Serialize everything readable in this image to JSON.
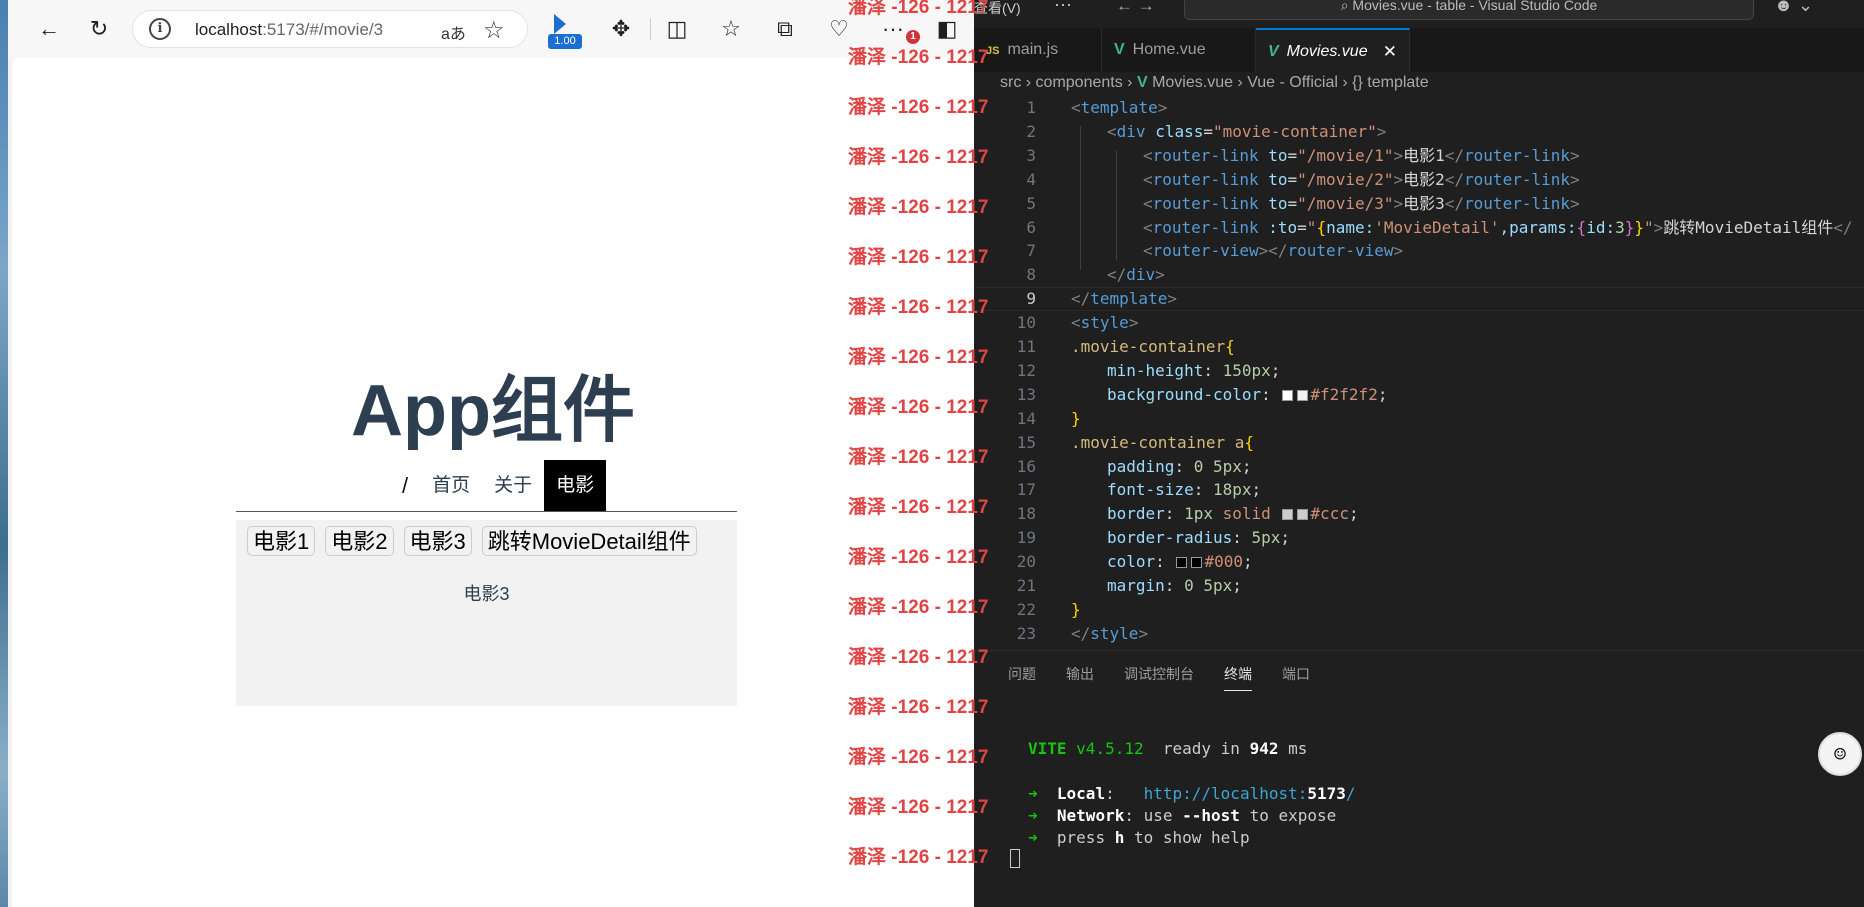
{
  "browser": {
    "url_host": "localhost",
    "url_rest": ":5173/#/movie/3",
    "read_aloud": "aあ",
    "zoom_badge": "1.00",
    "notification_count": "1"
  },
  "app": {
    "title": "App组件",
    "nav": [
      "/",
      "首页",
      "关于",
      "电影"
    ],
    "movie_links": [
      "电影1",
      "电影2",
      "电影3",
      "跳转MovieDetail组件"
    ],
    "router_view_text": "电影3"
  },
  "watermark": {
    "text": "潘泽 -126 - 1217",
    "repeat": 18
  },
  "vscode": {
    "menu_item": "查看(V)",
    "title": "Movies.vue - table - Visual Studio Code",
    "tabs": [
      {
        "icon": "JS",
        "label": "main.js"
      },
      {
        "icon": "V",
        "label": "Home.vue"
      },
      {
        "icon": "V",
        "label": "Movies.vue",
        "close": "✕"
      }
    ],
    "breadcrumb": [
      "src",
      "components",
      "Movies.vue",
      "Vue - Official",
      "template"
    ],
    "line_numbers": [
      "1",
      "2",
      "3",
      "4",
      "5",
      "6",
      "7",
      "8",
      "9",
      "10",
      "11",
      "12",
      "13",
      "14",
      "15",
      "16",
      "17",
      "18",
      "19",
      "20",
      "21",
      "22",
      "23"
    ],
    "code": {
      "l1": "template",
      "l2_tag": "div",
      "l2_attr": "class",
      "l2_val": "\"movie-container\"",
      "l3_to": "\"/movie/1\"",
      "l3_text": "电影1",
      "l4_to": "\"/movie/2\"",
      "l4_text": "电影2",
      "l5_to": "\"/movie/3\"",
      "l5_text": "电影3",
      "l6_name_key": "name:",
      "l6_name_val": "'MovieDetail'",
      "l6_params": ",params:",
      "l6_id": "id:",
      "l6_idval": "3",
      "l6_text": "跳转MovieDetail组件",
      "rl": "router-link",
      "rv": "router-view",
      "to": "to",
      "bind_to": ":to",
      "style": "style",
      "sel1": ".movie-container",
      "p_minh": "min-height",
      "v_minh": "150px",
      "p_bg": "background-color",
      "v_bg": "#f2f2f2",
      "sel2": ".movie-container a",
      "p_pad": "padding",
      "v_pad_a": "0",
      "v_pad_b": "5px",
      "p_fs": "font-size",
      "v_fs": "18px",
      "p_border": "border",
      "v_border_a": "1px",
      "v_border_b": "solid",
      "v_border_c": "#ccc",
      "p_br": "border-radius",
      "v_br": "5px",
      "p_color": "color",
      "v_color": "#000",
      "p_margin": "margin",
      "v_margin_a": "0",
      "v_margin_b": "5px"
    },
    "panel_tabs": [
      "问题",
      "输出",
      "调试控制台",
      "终端",
      "端口"
    ],
    "terminal": {
      "vite": "VITE",
      "version": "v4.5.12",
      "ready": "ready in",
      "ms_value": "942",
      "ms": "ms",
      "local_label": "Local",
      "local_url_a": "http://localhost:",
      "local_url_port": "5173",
      "local_url_b": "/",
      "network_label": "Network",
      "network_text_a": ": use ",
      "network_flag": "--host",
      "network_text_b": " to expose",
      "help_a": "press ",
      "help_key": "h",
      "help_b": " to show help"
    }
  },
  "colors": {
    "nav_active_bg": "#000000",
    "movie_box_bg": "#f2f2f2",
    "app_title": "#2c3e50",
    "vue_green": "#41b883",
    "watermark_red": "#e04545"
  }
}
